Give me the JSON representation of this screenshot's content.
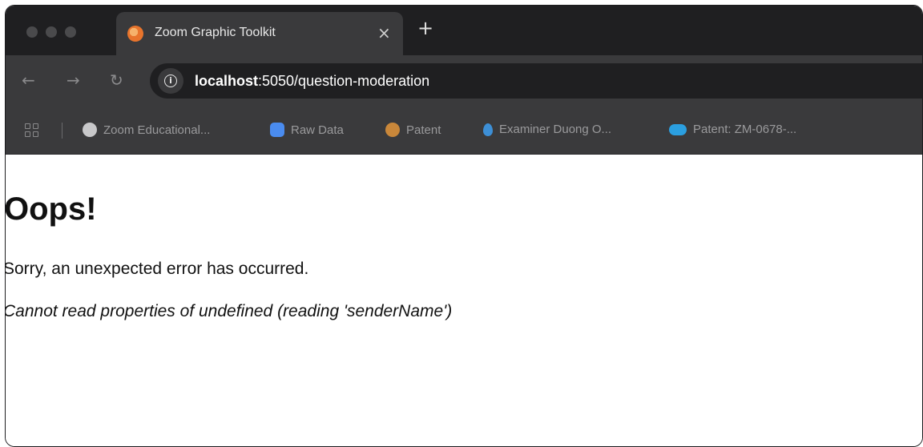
{
  "tab": {
    "title": "Zoom Graphic Toolkit",
    "close_glyph": "×",
    "new_tab_glyph": "+",
    "favicon": "zoom-toolkit-favicon"
  },
  "toolbar": {
    "back_glyph": "←",
    "forward_glyph": "→",
    "reload_glyph": "↻",
    "info_glyph": "i",
    "url_host": "localhost",
    "url_path": ":5050/question-moderation"
  },
  "bookmarks": [
    {
      "label": "Zoom Educational...",
      "icon": "globe-icon"
    },
    {
      "label": "Raw Data",
      "icon": "zoom-video-icon"
    },
    {
      "label": "Patent",
      "icon": "patent-icon"
    },
    {
      "label": "Examiner Duong O...",
      "icon": "droplet-icon"
    },
    {
      "label": "Patent: ZM-0678-...",
      "icon": "salesforce-cloud-icon"
    }
  ],
  "page": {
    "heading": "Oops!",
    "message": "Sorry, an unexpected error has occurred.",
    "error": "Cannot read properties of undefined (reading 'senderName')"
  },
  "colors": {
    "tabstrip_bg": "#1f1f21",
    "toolbar_bg": "#3a3a3c",
    "omnibox_bg": "#1f1f21",
    "page_bg": "#ffffff"
  }
}
